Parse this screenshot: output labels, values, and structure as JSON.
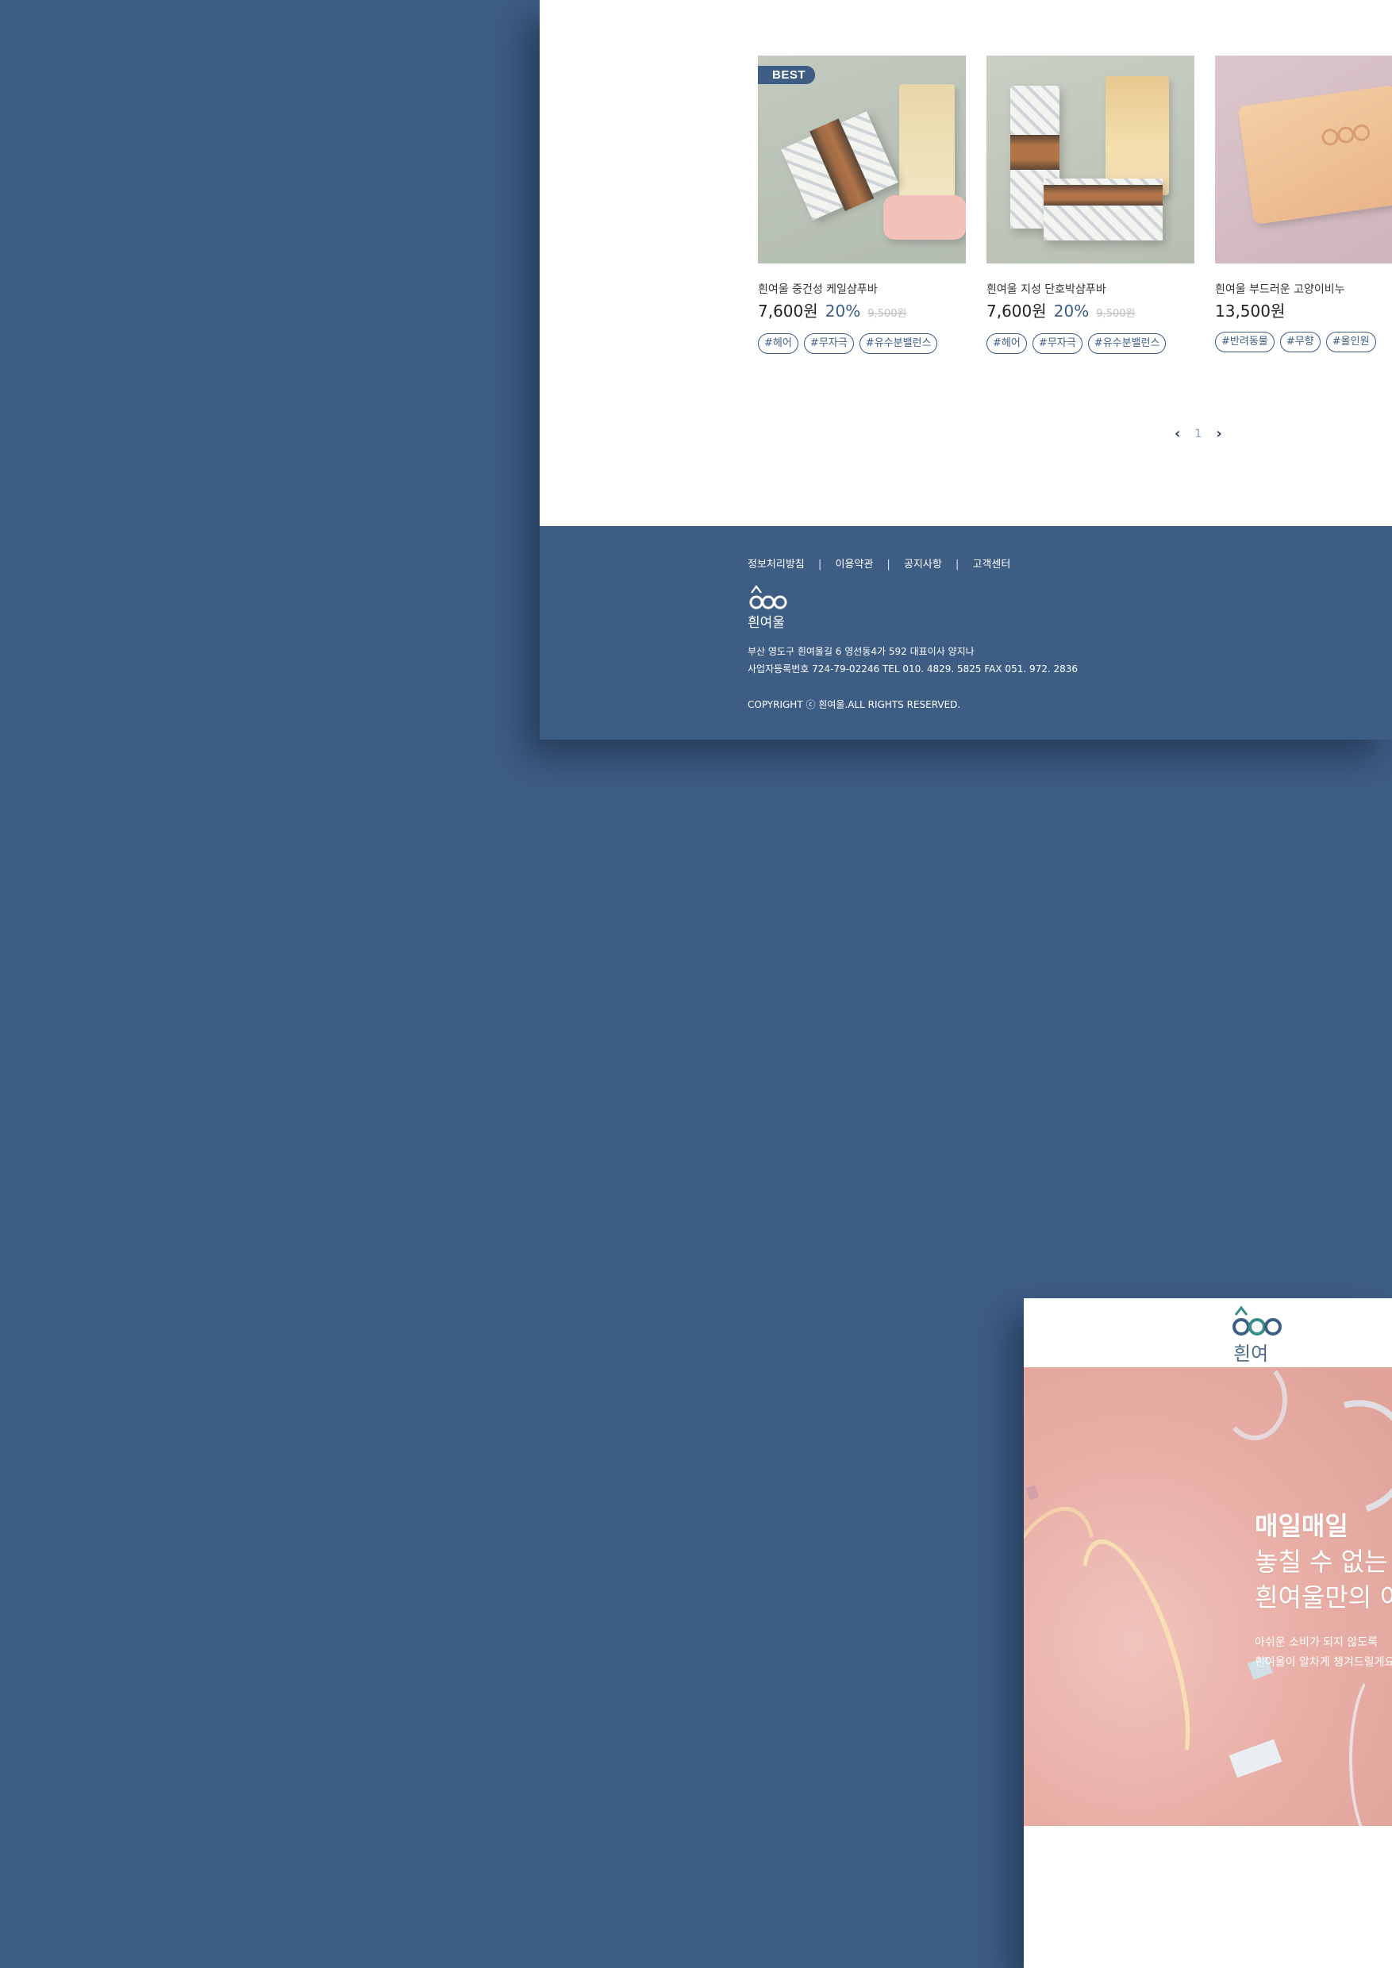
{
  "listing": {
    "products": [
      {
        "badge": "BEST",
        "name": "흰여울 중건성 케일샴푸바",
        "price": "7,600원",
        "discount": "20%",
        "original_price": "9,500원",
        "tags": [
          "#헤어",
          "#무자극",
          "#유수분밸런스"
        ]
      },
      {
        "name": "흰여울 지성 단호박샴푸바",
        "price": "7,600원",
        "discount": "20%",
        "original_price": "9,500원",
        "tags": [
          "#헤어",
          "#무자극",
          "#유수분밸런스"
        ]
      },
      {
        "name": "흰여울 부드러운 고양이비누",
        "price": "13,500원",
        "tags": [
          "#반려동물",
          "#무향",
          "#올인원"
        ]
      }
    ],
    "pagination": {
      "prev_icon": "chevron-left-icon",
      "current_page": "1",
      "next_icon": "chevron-right-icon"
    }
  },
  "footer": {
    "links": [
      "정보처리방침",
      "이용약관",
      "공지사항",
      "고객센터"
    ],
    "separator": "|",
    "logo_text": "흰여울",
    "address_line1": "부산 영도구 흰여울길 6 영선동4가 592 대표이사 양지나",
    "address_line2": "사업자등록번호 724-79-02246 TEL 010. 4829. 5825 FAX 051. 972. 2836",
    "copyright": "COPYRIGHT ⓒ 흰여울.ALL RIGHTS RESERVED."
  },
  "event_page": {
    "logo_text": "흰여울",
    "hero": {
      "title_line1": "매일매일",
      "title_line2": "놓칠 수 없는",
      "title_line3": "흰여울만의 이",
      "sub_line1": "아쉬운 소비가 되지 않도록",
      "sub_line2": "흰여울이 알차게 챙겨드릴게요"
    }
  },
  "colors": {
    "background": "#3e5d85",
    "accent": "#3e5d85",
    "strike_price": "#bdbdbd",
    "hero_pink": "#e9b0a8"
  }
}
